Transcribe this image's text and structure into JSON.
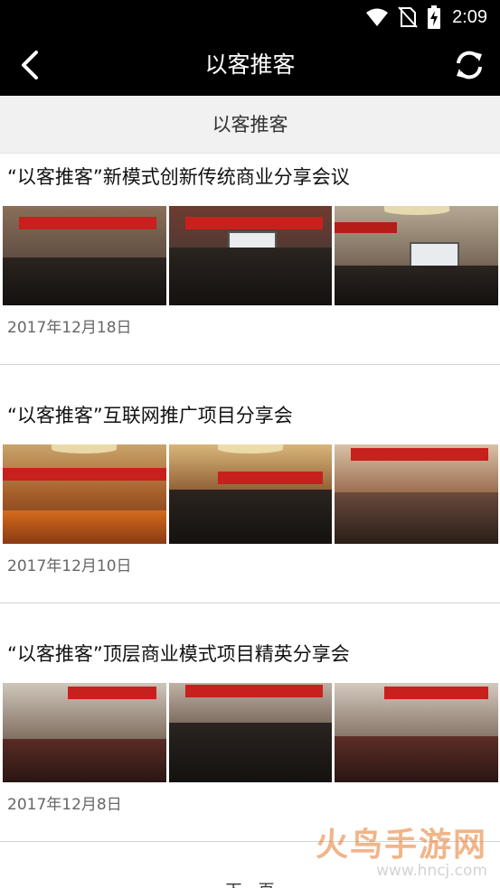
{
  "status_bar": {
    "time": "2:09",
    "icons": [
      "wifi-icon",
      "no-sim-icon",
      "battery-charging-icon"
    ]
  },
  "header": {
    "title": "以客推客",
    "back_icon": "back-chevron-icon",
    "refresh_icon": "refresh-icon"
  },
  "section": {
    "label": "以客推客"
  },
  "articles": [
    {
      "title": "“以客推客”新模式创新传统商业分享会议",
      "date": "2017年12月18日"
    },
    {
      "title": "“以客推客”互联网推广项目分享会",
      "date": "2017年12月10日"
    },
    {
      "title": "“以客推客”顶层商业模式项目精英分享会",
      "date": "2017年12月8日"
    }
  ],
  "pagination": {
    "next_label": "下一页"
  },
  "watermark": {
    "main": "火鸟手游网",
    "sub": "www.hncj.com"
  },
  "colors": {
    "header_bg": "#000000",
    "section_bg": "#f1f1f1",
    "banner_red": "#c8201c"
  }
}
